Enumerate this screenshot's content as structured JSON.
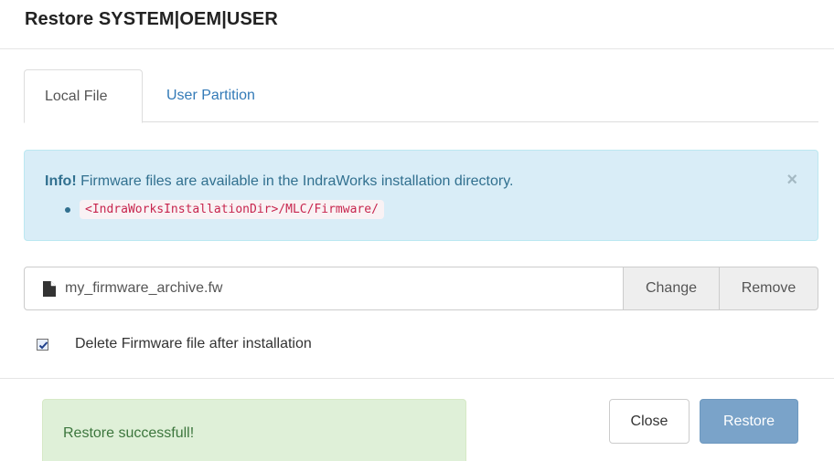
{
  "dialog": {
    "title": "Restore SYSTEM|OEM|USER"
  },
  "tabs": [
    {
      "label": "Local File",
      "active": true
    },
    {
      "label": "User Partition",
      "active": false
    }
  ],
  "info_alert": {
    "strong": "Info!",
    "message": " Firmware files are available in the IndraWorks installation directory.",
    "path": "<IndraWorksInstallationDir>/MLC/Firmware/",
    "close_glyph": "×",
    "colors": {
      "background": "#d9edf7",
      "border": "#bce8f1",
      "text": "#31708f"
    }
  },
  "file_input": {
    "filename": "my_firmware_archive.fw",
    "icon": "file-icon",
    "change_label": "Change",
    "remove_label": "Remove"
  },
  "delete_option": {
    "label": "Delete Firmware file after installation",
    "checked": true
  },
  "status_alert": {
    "message": "Restore successfull!",
    "colors": {
      "background": "#dff0d8",
      "text": "#3c763d"
    }
  },
  "footer": {
    "close_label": "Close",
    "restore_label": "Restore",
    "colors": {
      "restore_background": "#7aa3c9"
    }
  }
}
